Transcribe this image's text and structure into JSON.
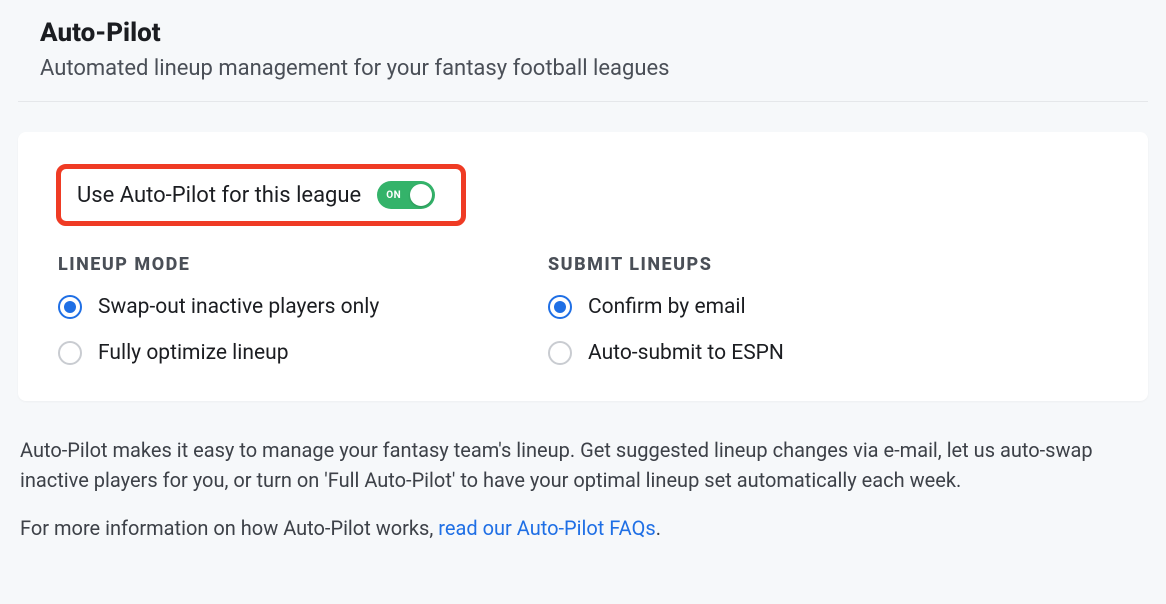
{
  "header": {
    "title": "Auto-Pilot",
    "subtitle": "Automated lineup management for your fantasy football leagues"
  },
  "toggle": {
    "label": "Use Auto-Pilot for this league",
    "state_text": "ON"
  },
  "lineup_mode": {
    "heading": "LINEUP MODE",
    "options": [
      {
        "label": "Swap-out inactive players only",
        "selected": true
      },
      {
        "label": "Fully optimize lineup",
        "selected": false
      }
    ]
  },
  "submit_lineups": {
    "heading": "SUBMIT LINEUPS",
    "options": [
      {
        "label": "Confirm by email",
        "selected": true
      },
      {
        "label": "Auto-submit to ESPN",
        "selected": false
      }
    ]
  },
  "description": {
    "para1": "Auto-Pilot makes it easy to manage your fantasy team's lineup. Get suggested lineup changes via e-mail, let us auto-swap inactive players for you, or turn on 'Full Auto-Pilot' to have your optimal lineup set automatically each week.",
    "para2_prefix": "For more information on how Auto-Pilot works, ",
    "para2_link": "read our Auto-Pilot FAQs",
    "para2_suffix": "."
  }
}
